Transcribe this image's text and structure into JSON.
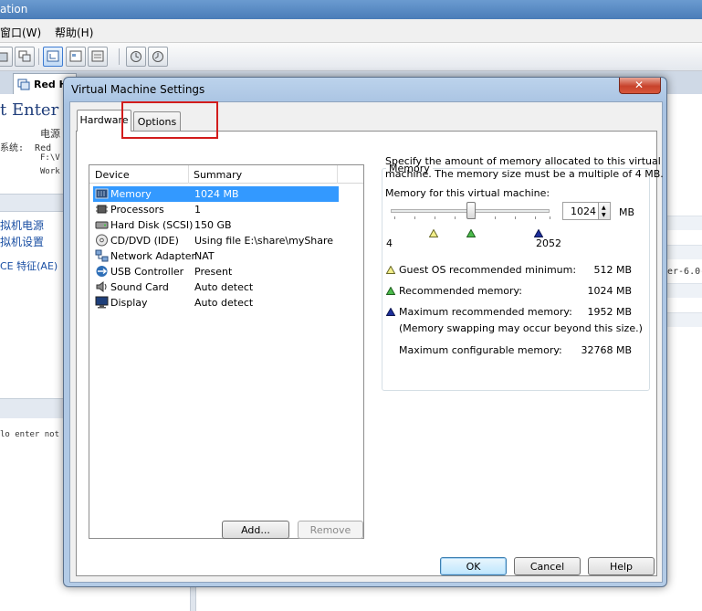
{
  "background_window": {
    "title_fragment": "ation",
    "menu": [
      "窗口(W)",
      "帮助(H)"
    ],
    "tab_label": "Red H",
    "vm_title_fragment": "t Enter",
    "info_lines": [
      "电源",
      "系统:  Red",
      "F:\\V",
      "Work"
    ],
    "links": [
      "拟机电源",
      "拟机设置",
      "CE 特征(AE)"
    ],
    "notes_fragment": "lo enter not",
    "right_fragment": "er-6.0-"
  },
  "dialog": {
    "title": "Virtual Machine Settings",
    "close_glyph": "✕",
    "tabs": [
      {
        "label": "Hardware",
        "active": true
      },
      {
        "label": "Options",
        "active": false
      }
    ],
    "device_columns": [
      "Device",
      "Summary"
    ],
    "devices": [
      {
        "name": "Memory",
        "summary": "1024 MB",
        "icon": "memory-icon",
        "selected": true
      },
      {
        "name": "Processors",
        "summary": "1",
        "icon": "processor-icon",
        "selected": false
      },
      {
        "name": "Hard Disk (SCSI)",
        "summary": "150 GB",
        "icon": "hard-disk-icon",
        "selected": false
      },
      {
        "name": "CD/DVD (IDE)",
        "summary": "Using file E:\\share\\myShare\\...",
        "icon": "cd-dvd-icon",
        "selected": false
      },
      {
        "name": "Network Adapter",
        "summary": "NAT",
        "icon": "network-adapter-icon",
        "selected": false
      },
      {
        "name": "USB Controller",
        "summary": "Present",
        "icon": "usb-icon",
        "selected": false
      },
      {
        "name": "Sound Card",
        "summary": "Auto detect",
        "icon": "sound-card-icon",
        "selected": false
      },
      {
        "name": "Display",
        "summary": "Auto detect",
        "icon": "display-icon",
        "selected": false
      }
    ],
    "add_button": "Add...",
    "remove_button": "Remove",
    "memory": {
      "legend": "Memory",
      "description_line1": "Specify the amount of memory allocated to this virtual",
      "description_line2": "machine. The memory size must be a multiple of 4 MB.",
      "field_label": "Memory for this virtual machine:",
      "value": "1024",
      "unit": "MB",
      "slider_min_label": "4",
      "slider_max_label": "2052",
      "guest_min_label": "Guest OS recommended minimum:",
      "guest_min_value": "512 MB",
      "recommended_label": "Recommended memory:",
      "recommended_value": "1024 MB",
      "max_recommended_label": "Maximum recommended memory:",
      "max_recommended_value": "1952 MB",
      "swap_note": "(Memory swapping may occur beyond this size.)",
      "max_configurable_label": "Maximum configurable memory:",
      "max_configurable_value": "32768 MB"
    },
    "ok_button": "OK",
    "cancel_button": "Cancel",
    "help_button": "Help"
  },
  "colors": {
    "selection": "#3399ff",
    "highlight_box": "#d21c1c",
    "marker_yellow": "#f2ee8a",
    "marker_green": "#4cbb4c",
    "marker_blue": "#1d2f9c"
  }
}
